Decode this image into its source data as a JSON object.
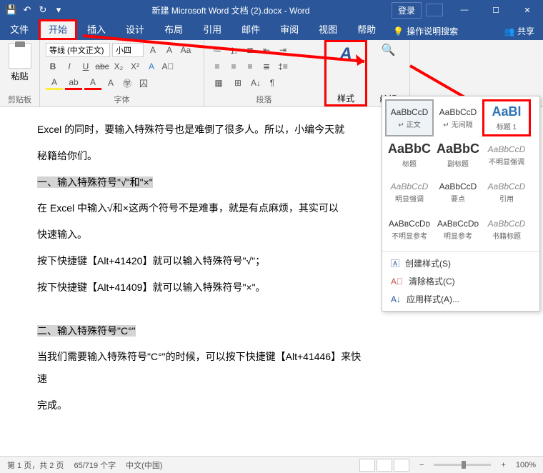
{
  "title": "新建 Microsoft Word 文档 (2).docx - Word",
  "login": "登录",
  "tabs": {
    "file": "文件",
    "home": "开始",
    "insert": "插入",
    "design": "设计",
    "layout": "布局",
    "references": "引用",
    "mailings": "邮件",
    "review": "审阅",
    "view": "视图",
    "help": "帮助",
    "tell_me": "操作说明搜索",
    "share": "共享"
  },
  "ribbon": {
    "clipboard": {
      "paste": "粘贴",
      "label": "剪贴板"
    },
    "font": {
      "name": "等线 (中文正文)",
      "size": "小四",
      "label": "字体",
      "buttons": {
        "bold": "B",
        "italic": "I",
        "underline": "U",
        "strike": "abc",
        "sub": "X₂",
        "sup": "X²",
        "inc": "A",
        "dec": "A",
        "case": "Aa",
        "clear": "A",
        "color": "A",
        "highlight": "ab",
        "effects": "A",
        "enclose": "㊫",
        "border": "A"
      }
    },
    "para": {
      "label": "段落"
    },
    "styles": {
      "label": "样式"
    },
    "editing": {
      "label": "编辑"
    }
  },
  "gallery": {
    "items": [
      {
        "preview": "AaBbCcD",
        "name": "↵ 正文",
        "cls": ""
      },
      {
        "preview": "AaBbCcD",
        "name": "↵ 无间隔",
        "cls": ""
      },
      {
        "preview": "AaBl",
        "name": "标题 1",
        "cls": "big blue"
      },
      {
        "preview": "AaBbC",
        "name": "标题",
        "cls": "big"
      },
      {
        "preview": "AaBbC",
        "name": "副标题",
        "cls": "big"
      },
      {
        "preview": "AaBbCcD",
        "name": "不明显强调",
        "cls": "italic"
      },
      {
        "preview": "AaBbCcD",
        "name": "明显强调",
        "cls": "italic blue"
      },
      {
        "preview": "AaBbCcD",
        "name": "要点",
        "cls": ""
      },
      {
        "preview": "AaBbCcD",
        "name": "引用",
        "cls": "italic"
      },
      {
        "preview": "AᴀBʙCᴄDᴅ",
        "name": "不明显参考",
        "cls": "sc"
      },
      {
        "preview": "AᴀBʙCᴄDᴅ",
        "name": "明显参考",
        "cls": "sc"
      },
      {
        "preview": "AaBbCcD",
        "name": "书籍标题",
        "cls": "italic"
      }
    ],
    "menu": {
      "create": "创建样式(S)",
      "clear": "清除格式(C)",
      "apply": "应用样式(A)..."
    }
  },
  "doc": {
    "p1": "Excel 的同时，要输入特殊符号也是难倒了很多人。所以，小编今天就",
    "p2": "秘籍给你们。",
    "h1": "一、输入特殊符号\"√\"和\"×\"",
    "p3": "在 Excel 中输入√和×这两个符号不是难事，就是有点麻烦，其实可以",
    "p4": "快速输入。",
    "p5": "按下快捷键【Alt+41420】就可以输入特殊符号\"√\"；",
    "p6": "按下快捷键【Alt+41409】就可以输入特殊符号\"×\"。",
    "h2": "二、输入特殊符号\"C°\"",
    "p7": "当我们需要输入特殊符号\"C°\"的时候，可以按下快捷键【Alt+41446】来快速",
    "p8": "完成。"
  },
  "status": {
    "pages": "第 1 页，共 2 页",
    "words": "65/719 个字",
    "lang": "中文(中国)",
    "zoom": "100%"
  }
}
